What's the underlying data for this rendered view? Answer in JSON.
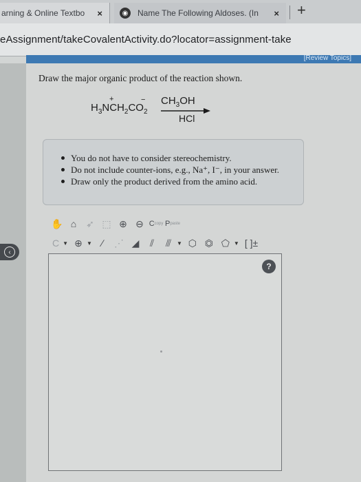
{
  "browser": {
    "tabs": [
      {
        "title": "arning & Online Textbo",
        "close": "×"
      },
      {
        "title": "Name The Following Aldoses. (In",
        "close": "×"
      }
    ],
    "new_tab": "+",
    "url": "eAssignment/takeCovalentActivity.do?locator=assignment-take"
  },
  "page": {
    "review_topics": "[Review Topics]",
    "question": "Draw the major organic product of the reaction shown.",
    "reaction": {
      "reactant_main": "H",
      "reactant_sub1": "3",
      "reactant_n": "NCH",
      "reactant_sub2": "2",
      "reactant_co": "CO",
      "reactant_sub3": "2",
      "reactant_plus": "+",
      "reactant_minus": "−",
      "reagent_top": "CH",
      "reagent_top_sub": "3",
      "reagent_top_end": "OH",
      "reagent_bottom": "HCl"
    },
    "instructions": [
      "You do not have to consider stereochemistry.",
      "Do not include counter-ions, e.g., Na⁺, I⁻, in your answer.",
      "Draw only the product derived from the amino acid."
    ]
  },
  "toolbar": {
    "copy_letter": "C",
    "copy_label": "copy",
    "paste_letter": "P",
    "paste_label": "paste",
    "atom_label": "C",
    "charge_symbol": "⊕",
    "bracket_label": "[ ]±"
  },
  "canvas": {
    "help": "?"
  }
}
